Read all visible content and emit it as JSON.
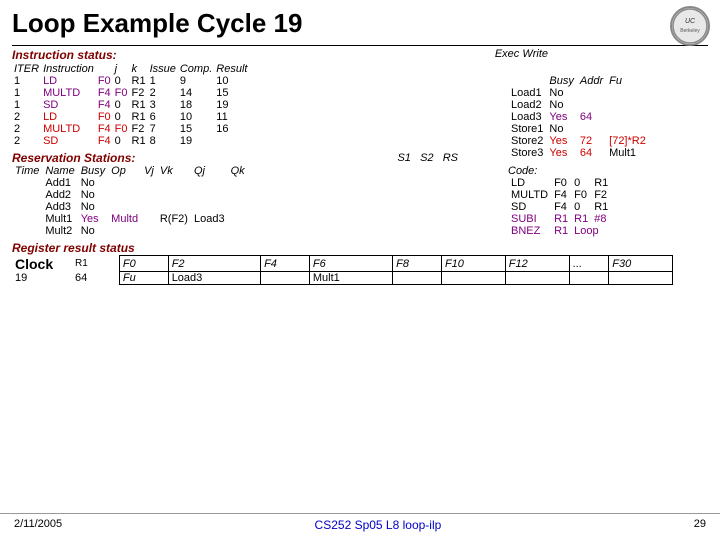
{
  "title": "Loop Example Cycle 19",
  "logo_text": "UC",
  "sections": {
    "instruction_status_label": "Instruction status:",
    "exec_write_label": "Exec  Write",
    "reservation_stations_label": "Reservation Stations:",
    "register_result_label": "Register result status"
  },
  "instruction_table": {
    "headers": [
      "ITER",
      "Instruction",
      "",
      "j",
      "k",
      "Issue",
      "Comp.",
      "Result"
    ],
    "rows": [
      [
        "1",
        "LD",
        "F0",
        "0",
        "R1",
        "1",
        "9",
        "10"
      ],
      [
        "1",
        "MULTD",
        "F4",
        "F0",
        "F2",
        "2",
        "14",
        "15"
      ],
      [
        "1",
        "SD",
        "F4",
        "0",
        "R1",
        "3",
        "18",
        "19"
      ],
      [
        "2",
        "LD",
        "F0",
        "0",
        "R1",
        "6",
        "10",
        "11"
      ],
      [
        "2",
        "MULTD",
        "F4",
        "F0",
        "F2",
        "7",
        "15",
        "16"
      ],
      [
        "2",
        "SD",
        "F4",
        "0",
        "R1",
        "8",
        "19",
        ""
      ]
    ]
  },
  "rob_table": {
    "headers": [
      "",
      "Busy",
      "Addr",
      "Fu"
    ],
    "rows": [
      [
        "Load1",
        "No",
        "",
        ""
      ],
      [
        "Load2",
        "No",
        "",
        ""
      ],
      [
        "Load3",
        "Yes",
        "64",
        ""
      ],
      [
        "Store1",
        "No",
        "",
        ""
      ],
      [
        "Store2",
        "Yes",
        "72",
        "[72]*R2"
      ],
      [
        "Store3",
        "Yes",
        "64",
        "Mult1"
      ]
    ]
  },
  "rs_table": {
    "headers": [
      "Time",
      "Name",
      "Busy",
      "Op",
      "Vj",
      "Vk",
      "Qj",
      "Qk"
    ],
    "s1_s2_rs_headers": [
      "S1",
      "S2",
      "RS"
    ],
    "rows": [
      [
        "",
        "Add1",
        "No",
        "",
        "",
        "",
        "",
        ""
      ],
      [
        "",
        "Add2",
        "No",
        "",
        "",
        "",
        "",
        ""
      ],
      [
        "",
        "Add3",
        "No",
        "",
        "",
        "",
        "",
        ""
      ],
      [
        "",
        "Mult1",
        "Yes",
        "Multd",
        "",
        "R(F2)",
        "Load3",
        ""
      ],
      [
        "",
        "Mult2",
        "No",
        "",
        "",
        "",
        "",
        ""
      ]
    ]
  },
  "code_section": {
    "label": "Code:",
    "rows": [
      [
        "LD",
        "F0",
        "0",
        "R1"
      ],
      [
        "MULTD",
        "F4",
        "F0",
        "F2"
      ],
      [
        "SD",
        "F4",
        "0",
        "R1"
      ],
      [
        "SUBI",
        "R1",
        "R1",
        "#8"
      ],
      [
        "BNEZ",
        "R1",
        "Loop",
        ""
      ]
    ]
  },
  "register_status": {
    "label": "Register result status",
    "clock_label": "Clock",
    "r1_label": "R1",
    "fu_label": "Fu",
    "registers": [
      "F0",
      "F2",
      "F4",
      "F6",
      "F8",
      "F10",
      "F12",
      "...",
      "F30"
    ],
    "row1": [
      "19",
      "64",
      "Fu",
      "Load3",
      "",
      "Mult1",
      "",
      "",
      "",
      "",
      ""
    ],
    "clock_val": "19",
    "addr_val": "64"
  },
  "footer": {
    "left": "2/11/2005",
    "center": "CS252 Sp05 L8 loop-ilp",
    "right": "29"
  }
}
